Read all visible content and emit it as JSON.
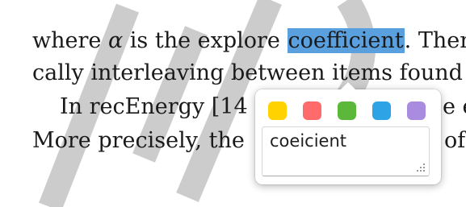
{
  "document": {
    "line1": {
      "before": "where ",
      "math": "α",
      "middle": " is the explore ",
      "highlighted": "coefficient",
      "after": ". Ther"
    },
    "line2": "cally interleaving between items found",
    "line3": "In recEnergy [14",
    "line3_tail": "e e",
    "line4": "More precisely, the",
    "line4_tail": "of"
  },
  "annotation_popup": {
    "colors": [
      {
        "name": "yellow",
        "hex": "#ffd200"
      },
      {
        "name": "red",
        "hex": "#ff6b6b"
      },
      {
        "name": "green",
        "hex": "#5cb83a"
      },
      {
        "name": "blue",
        "hex": "#2ea3e6"
      },
      {
        "name": "purple",
        "hex": "#a98be0"
      }
    ],
    "note_value": "coeicient",
    "resize_icon": "resize-grip-icon"
  },
  "colors": {
    "highlight": "#5aa0df",
    "watermark": "#cccccc"
  }
}
